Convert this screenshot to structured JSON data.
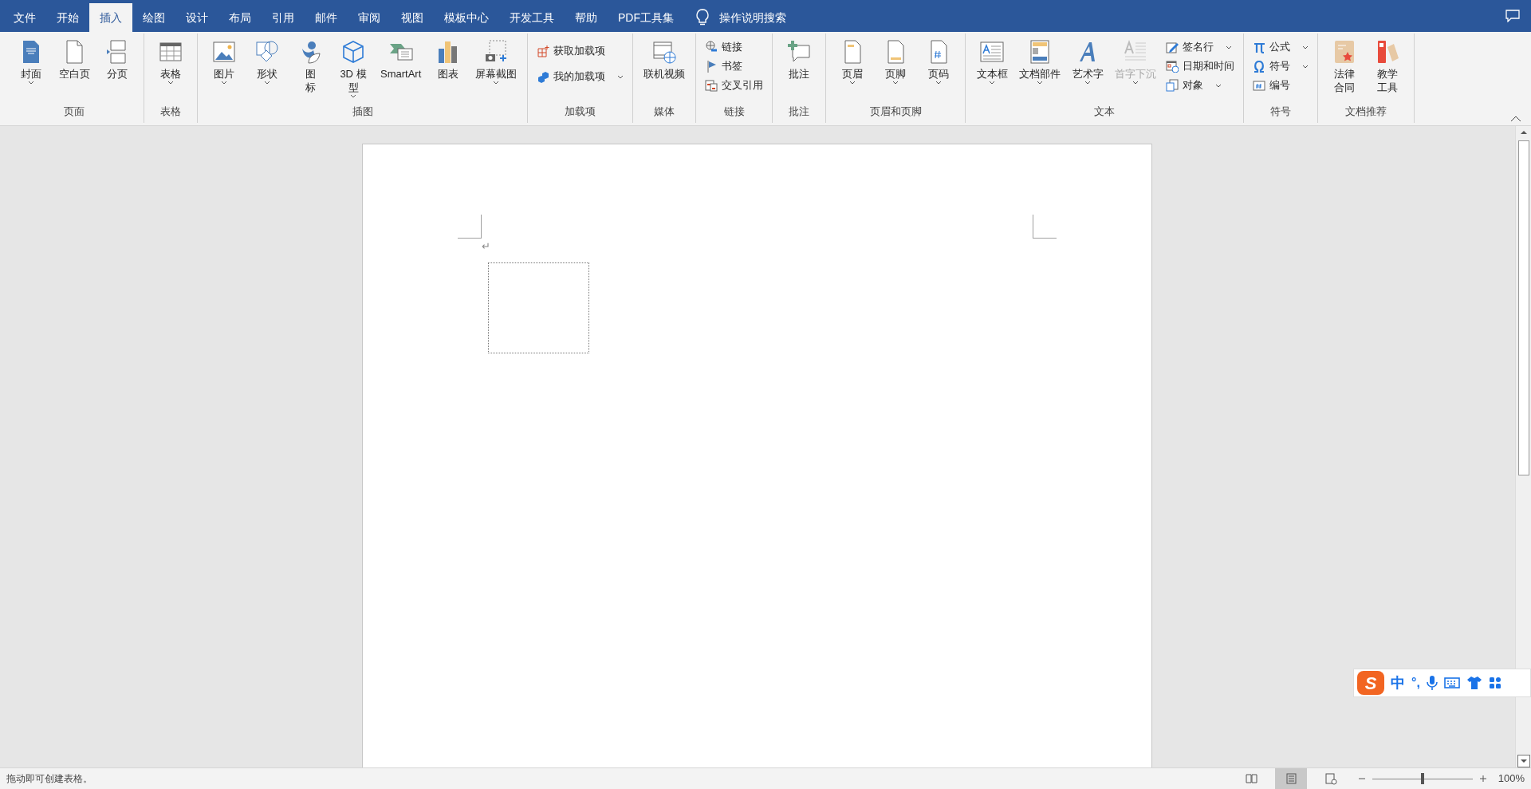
{
  "tabs": [
    {
      "label": "文件",
      "selected": false
    },
    {
      "label": "开始",
      "selected": false
    },
    {
      "label": "插入",
      "selected": true
    },
    {
      "label": "绘图",
      "selected": false
    },
    {
      "label": "设计",
      "selected": false
    },
    {
      "label": "布局",
      "selected": false
    },
    {
      "label": "引用",
      "selected": false
    },
    {
      "label": "邮件",
      "selected": false
    },
    {
      "label": "审阅",
      "selected": false
    },
    {
      "label": "视图",
      "selected": false
    },
    {
      "label": "模板中心",
      "selected": false
    },
    {
      "label": "开发工具",
      "selected": false
    },
    {
      "label": "帮助",
      "selected": false
    },
    {
      "label": "PDF工具集",
      "selected": false
    }
  ],
  "search": {
    "placeholder": "操作说明搜索"
  },
  "ribbon": {
    "groups": [
      {
        "label": "页面",
        "items": [
          {
            "kind": "large",
            "lines": [
              "封面"
            ],
            "dropdown": true,
            "disabled": false
          },
          {
            "kind": "large",
            "lines": [
              "空白页"
            ],
            "dropdown": false,
            "disabled": false
          },
          {
            "kind": "large",
            "lines": [
              "分页"
            ],
            "dropdown": false,
            "disabled": false
          }
        ]
      },
      {
        "label": "表格",
        "items": [
          {
            "kind": "large",
            "lines": [
              "表格"
            ],
            "dropdown": true,
            "disabled": false
          }
        ]
      },
      {
        "label": "插图",
        "items": [
          {
            "kind": "large",
            "lines": [
              "图片"
            ],
            "dropdown": true,
            "disabled": false
          },
          {
            "kind": "large",
            "lines": [
              "形状"
            ],
            "dropdown": true,
            "disabled": false
          },
          {
            "kind": "large",
            "lines": [
              "图",
              "标"
            ],
            "dropdown": false,
            "disabled": false
          },
          {
            "kind": "large",
            "lines": [
              "3D 模",
              "型"
            ],
            "dropdown": true,
            "disabled": false
          },
          {
            "kind": "large",
            "lines": [
              "SmartArt"
            ],
            "dropdown": false,
            "disabled": false
          },
          {
            "kind": "large",
            "lines": [
              "图表"
            ],
            "dropdown": false,
            "disabled": false
          },
          {
            "kind": "large",
            "lines": [
              "屏幕截图"
            ],
            "dropdown": true,
            "disabled": false
          }
        ]
      },
      {
        "label": "加载项",
        "items": [
          {
            "kind": "small",
            "lines": [
              "获取加载项"
            ],
            "dropdown": false,
            "disabled": false
          },
          {
            "kind": "small",
            "lines": [
              "我的加载项"
            ],
            "dropdown": true,
            "disabled": false
          }
        ]
      },
      {
        "label": "媒体",
        "items": [
          {
            "kind": "large",
            "lines": [
              "联机视频"
            ],
            "dropdown": false,
            "disabled": false
          }
        ]
      },
      {
        "label": "链接",
        "items": [
          {
            "kind": "small",
            "lines": [
              "链接"
            ],
            "dropdown": false,
            "disabled": false
          },
          {
            "kind": "small",
            "lines": [
              "书签"
            ],
            "dropdown": false,
            "disabled": false
          },
          {
            "kind": "small",
            "lines": [
              "交叉引用"
            ],
            "dropdown": false,
            "disabled": false
          }
        ]
      },
      {
        "label": "批注",
        "items": [
          {
            "kind": "large",
            "lines": [
              "批注"
            ],
            "dropdown": false,
            "disabled": false
          }
        ]
      },
      {
        "label": "页眉和页脚",
        "items": [
          {
            "kind": "large",
            "lines": [
              "页眉"
            ],
            "dropdown": true,
            "disabled": false
          },
          {
            "kind": "large",
            "lines": [
              "页脚"
            ],
            "dropdown": true,
            "disabled": false
          },
          {
            "kind": "large",
            "lines": [
              "页码"
            ],
            "dropdown": true,
            "disabled": false
          }
        ]
      },
      {
        "label": "文本",
        "items": [
          {
            "kind": "large",
            "lines": [
              "文本框"
            ],
            "dropdown": true,
            "disabled": false
          },
          {
            "kind": "large",
            "lines": [
              "文档部件"
            ],
            "dropdown": true,
            "disabled": false
          },
          {
            "kind": "large",
            "lines": [
              "艺术字"
            ],
            "dropdown": true,
            "disabled": false
          },
          {
            "kind": "large",
            "lines": [
              "首字下沉"
            ],
            "dropdown": true,
            "disabled": true
          },
          {
            "kind": "small",
            "lines": [
              "签名行"
            ],
            "dropdown": true,
            "disabled": false
          },
          {
            "kind": "small",
            "lines": [
              "日期和时间"
            ],
            "dropdown": false,
            "disabled": false
          },
          {
            "kind": "small",
            "lines": [
              "对象"
            ],
            "dropdown": true,
            "disabled": false
          }
        ]
      },
      {
        "label": "符号",
        "items": [
          {
            "kind": "small",
            "lines": [
              "公式"
            ],
            "dropdown": true,
            "disabled": false
          },
          {
            "kind": "small",
            "lines": [
              "符号"
            ],
            "dropdown": true,
            "disabled": false
          },
          {
            "kind": "small",
            "lines": [
              "编号"
            ],
            "dropdown": false,
            "disabled": false
          }
        ]
      },
      {
        "label": "文档推荐",
        "items": [
          {
            "kind": "large",
            "lines": [
              "法律",
              "合同"
            ],
            "dropdown": false,
            "disabled": false
          },
          {
            "kind": "large",
            "lines": [
              "教学",
              "工具"
            ],
            "dropdown": false,
            "disabled": false
          }
        ]
      }
    ]
  },
  "document": {
    "paragraph_mark": "↵"
  },
  "ime_bar": {
    "logo": "S",
    "mode": "中",
    "punctuation": "°,"
  },
  "status_bar": {
    "message": "拖动即可创建表格。",
    "views": [
      {
        "kind": "read",
        "selected": false
      },
      {
        "kind": "print",
        "selected": true
      },
      {
        "kind": "web",
        "selected": false
      }
    ],
    "zoom": {
      "level": 0.5,
      "reading": "100%"
    }
  }
}
